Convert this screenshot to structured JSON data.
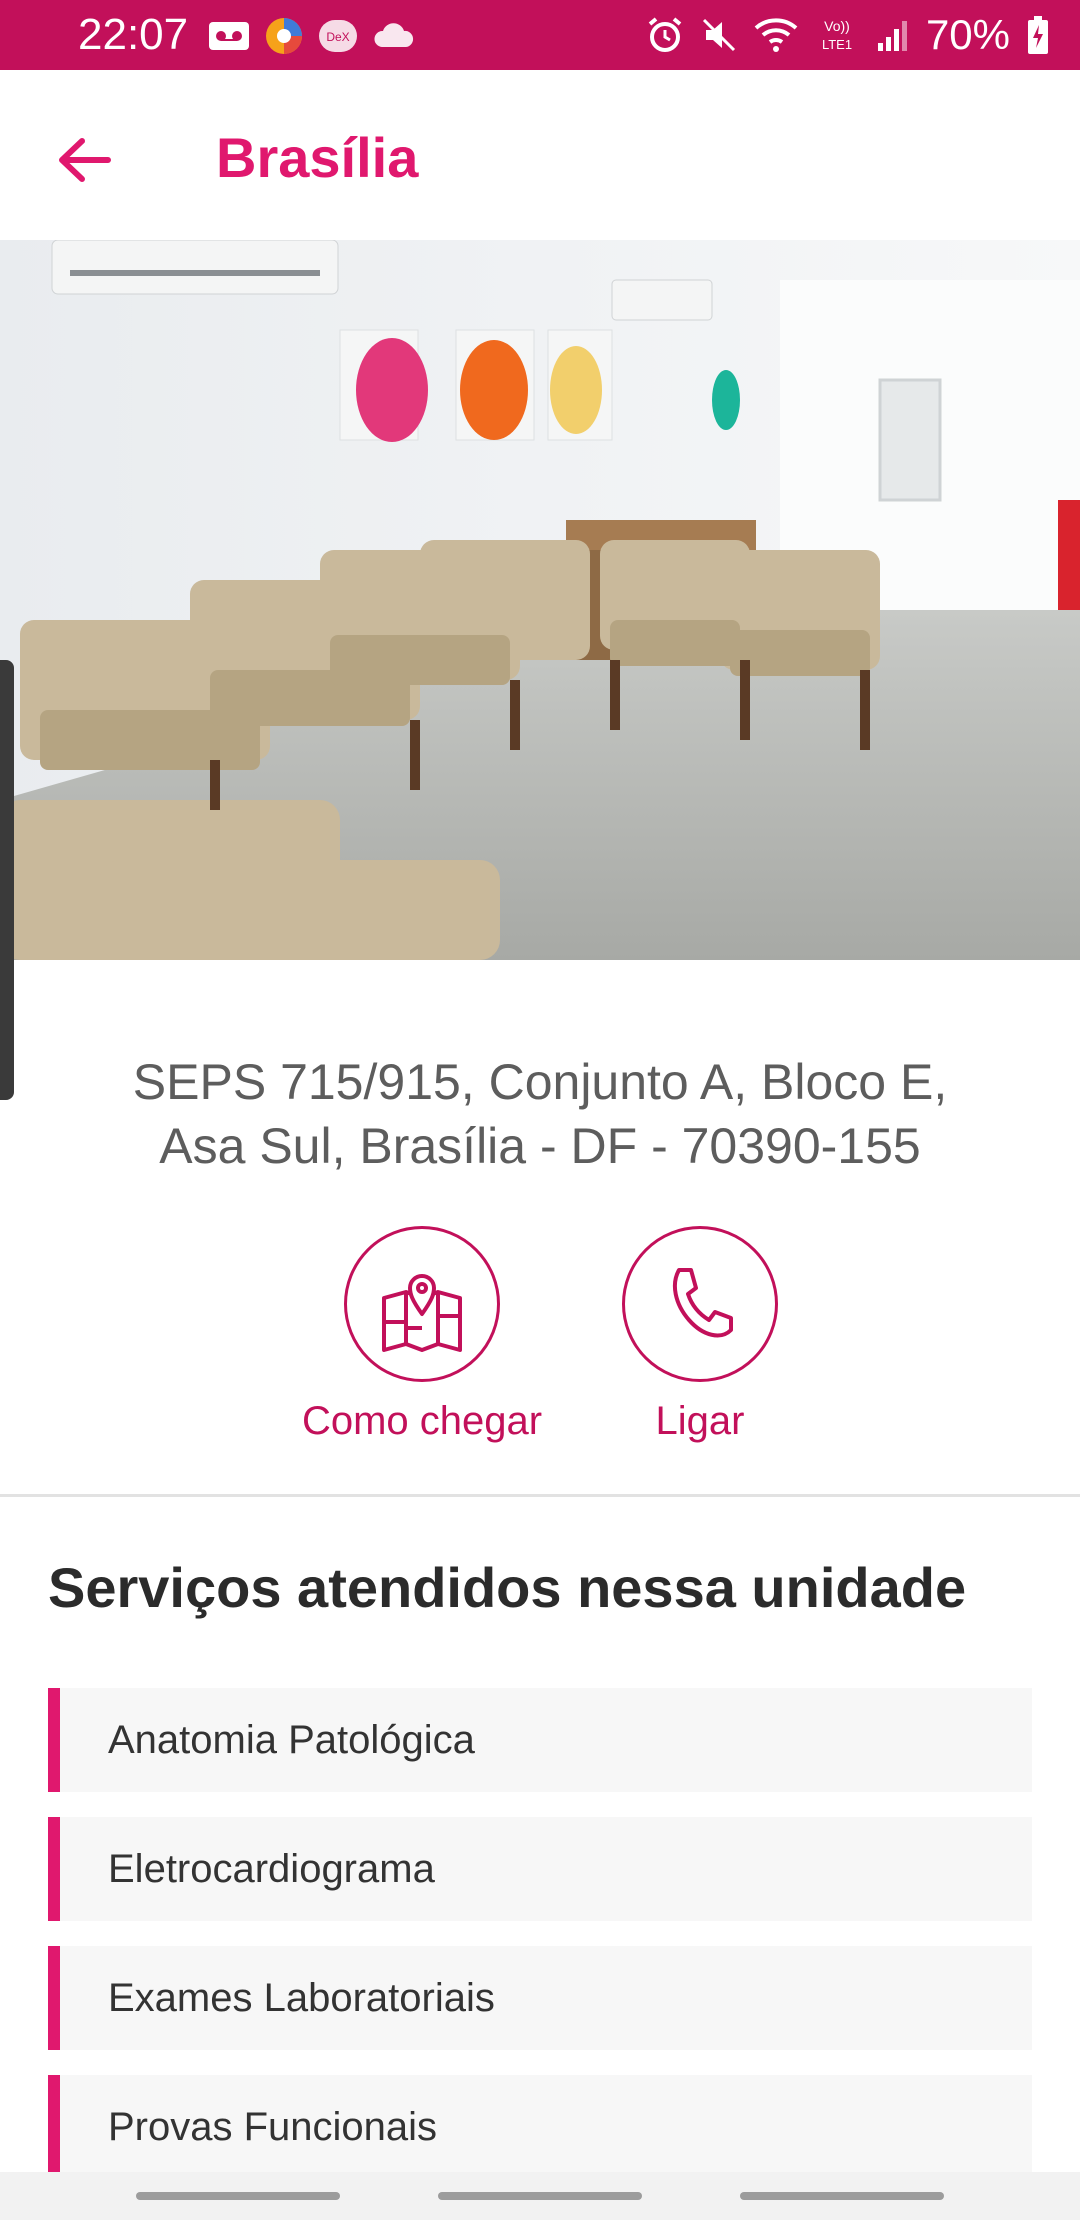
{
  "status_bar": {
    "time": "22:07",
    "battery_text": "70%",
    "icons": [
      "voicemail-icon",
      "browser-icon",
      "dex-icon",
      "cloud-icon",
      "alarm-icon",
      "mute-icon",
      "wifi-icon",
      "volte-icon",
      "signal-icon",
      "battery-icon"
    ]
  },
  "header": {
    "title": "Brasília",
    "back_icon": "arrow-left-icon"
  },
  "unit": {
    "address_line1": "SEPS 715/915, Conjunto A, Bloco E,",
    "address_line2": "Asa Sul, Brasília - DF - 70390-155"
  },
  "actions": [
    {
      "label": "Como chegar",
      "icon": "map-pin-icon"
    },
    {
      "label": "Ligar",
      "icon": "phone-icon"
    }
  ],
  "services": {
    "title": "Serviços atendidos nessa unidade",
    "items": [
      {
        "label": "Anatomia Patológica"
      },
      {
        "label": "Eletrocardiograma"
      },
      {
        "label": "Exames Laboratoriais"
      },
      {
        "label": "Provas Funcionais"
      }
    ]
  },
  "colors": {
    "brand": "#e0186e",
    "status_bar": "#c2105a",
    "text_dark": "#2b2b2b",
    "text_gray": "#5d5d5d"
  }
}
